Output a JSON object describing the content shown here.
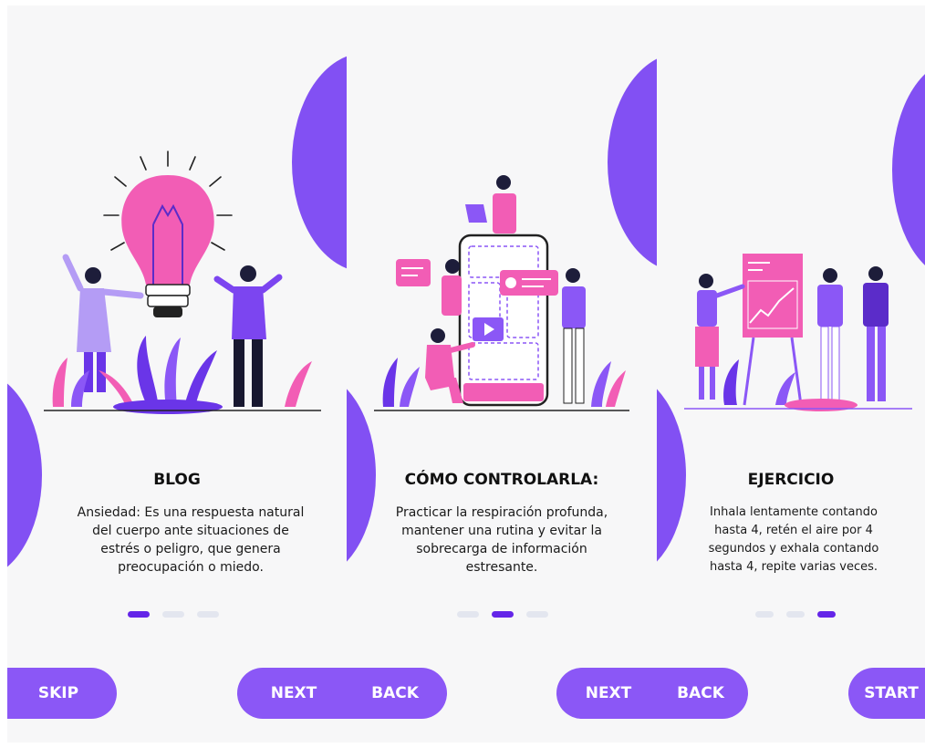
{
  "colors": {
    "accent": "#8b57f6",
    "accent_dark": "#6425e8",
    "pink": "#f25db5",
    "background": "#f7f7f8"
  },
  "screens": [
    {
      "title": "BLOG",
      "description": "Ansiedad: Es una respuesta natural del cuerpo ante situaciones de estrés o peligro, que genera preocupación o miedo.",
      "illustration": "lightbulb-idea-illustration",
      "active_dot": 0,
      "buttons": {
        "left": "SKIP",
        "right": "NEXT"
      }
    },
    {
      "title": "CÓMO CONTROLARLA:",
      "description": "Practicar la respiración profunda, mantener una rutina y evitar la sobrecarga de información estresante.",
      "illustration": "mobile-app-team-illustration",
      "active_dot": 1,
      "buttons": {
        "left": "BACK",
        "right": "NEXT"
      }
    },
    {
      "title": "EJERCICIO",
      "description": "Inhala lentamente contando hasta 4, retén el aire por 4 segundos y exhala contando hasta 4, repite varias veces.",
      "illustration": "presentation-chart-illustration",
      "active_dot": 2,
      "buttons": {
        "left": "BACK",
        "right": "START"
      }
    }
  ]
}
